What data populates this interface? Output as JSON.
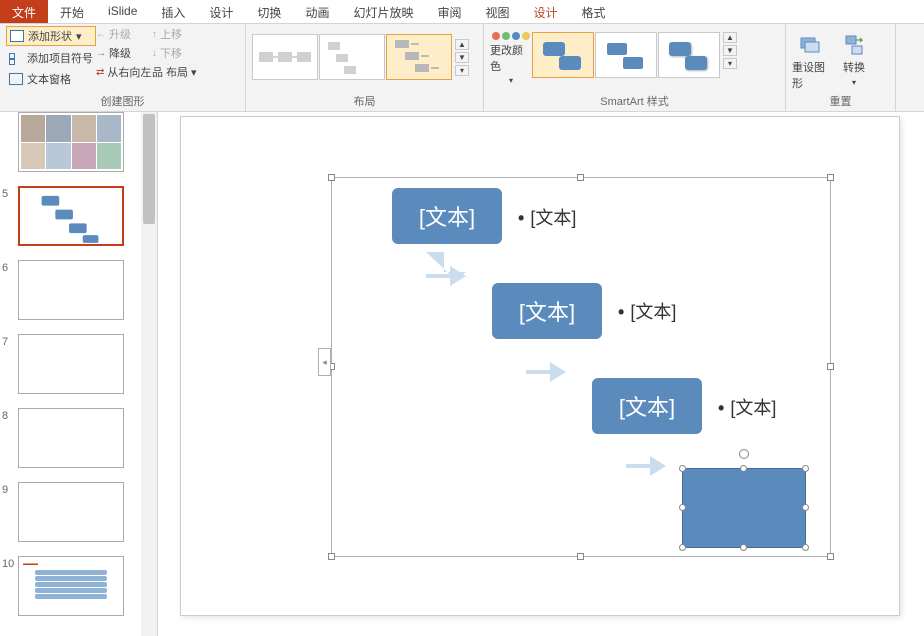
{
  "tabs": {
    "file": "文件",
    "home": "开始",
    "islide": "iSlide",
    "insert": "插入",
    "design": "设计",
    "transitions": "切换",
    "animations": "动画",
    "slideshow": "幻灯片放映",
    "review": "审阅",
    "view": "视图",
    "design2": "设计",
    "format": "格式"
  },
  "ribbon": {
    "add_shape": "添加形状",
    "add_bullet": "添加项目符号",
    "text_pane": "文本窗格",
    "promote": "升级",
    "demote": "降级",
    "rtl": "从右向左",
    "move_up": "上移",
    "move_down": "下移",
    "layout": "布局",
    "group_create": "创建图形",
    "group_layout": "布局",
    "change_colors": "更改颜色",
    "group_styles": "SmartArt 样式",
    "reset_graphic": "重设图形",
    "convert": "转换",
    "group_reset": "重置"
  },
  "thumbs": {
    "n4": "",
    "n5": "5",
    "n6": "6",
    "n7": "7",
    "n8": "8",
    "n9": "9",
    "n10": "10"
  },
  "smartart": {
    "placeholder": "[文本]",
    "bullet": "•"
  }
}
